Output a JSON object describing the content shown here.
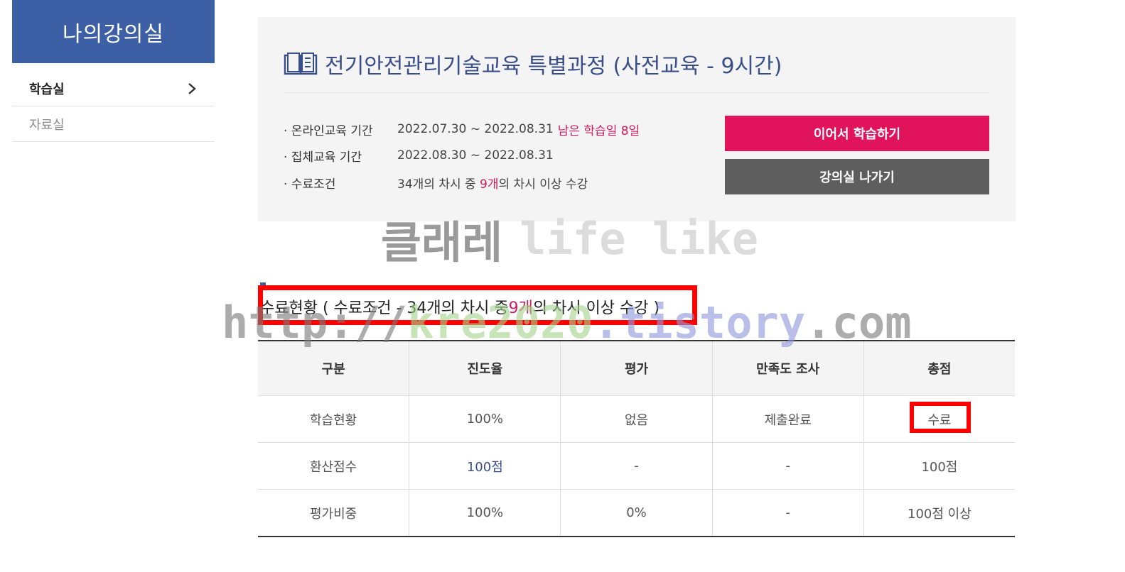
{
  "sidebar": {
    "title": "나의강의실",
    "items": [
      {
        "label": "학습실"
      },
      {
        "label": "자료실"
      }
    ]
  },
  "course": {
    "title": "전기안전관리기술교육 특별과정 (사전교육 - 9시간)",
    "rows": [
      {
        "label": "· 온라인교육 기간",
        "value": "2022.07.30 ~ 2022.08.31",
        "extra": "남은 학습일 8일"
      },
      {
        "label": "· 집체교육 기간",
        "value": "2022.08.30 ~ 2022.08.31",
        "extra": ""
      },
      {
        "label": "· 수료조건",
        "value_pre": "34개의 차시 중 ",
        "value_hl": "9개",
        "value_post": "의 차시 이상 수강"
      }
    ],
    "buttons": {
      "continue": "이어서 학습하기",
      "exit": "강의실 나가기"
    }
  },
  "watermarks": {
    "line1_korean": "클래레",
    "line1_english": "life like",
    "url_http": "http://",
    "url_kre": "kre2020",
    "url_tistory": ".tistory",
    "url_com": ".com"
  },
  "status": {
    "heading_pre": "수료현황 ( 수료조건 - 34개의 차시 중 ",
    "heading_hl": "9개",
    "heading_post": "의 차시 이상 수강 )"
  },
  "table": {
    "headers": [
      "구분",
      "진도율",
      "평가",
      "만족도 조사",
      "총점"
    ],
    "rows": [
      [
        "학습현황",
        "100%",
        "없음",
        "제출완료",
        "수료"
      ],
      [
        "환산점수",
        "100점",
        "-",
        "-",
        "100점"
      ],
      [
        "평가비중",
        "100%",
        "0%",
        "-",
        "100점 이상"
      ]
    ]
  },
  "colors": {
    "brand_blue": "#3d5fa6",
    "accent_pink": "#e0135b",
    "exit_gray": "#5e5e5e",
    "highlight_red": "#ff0000"
  }
}
